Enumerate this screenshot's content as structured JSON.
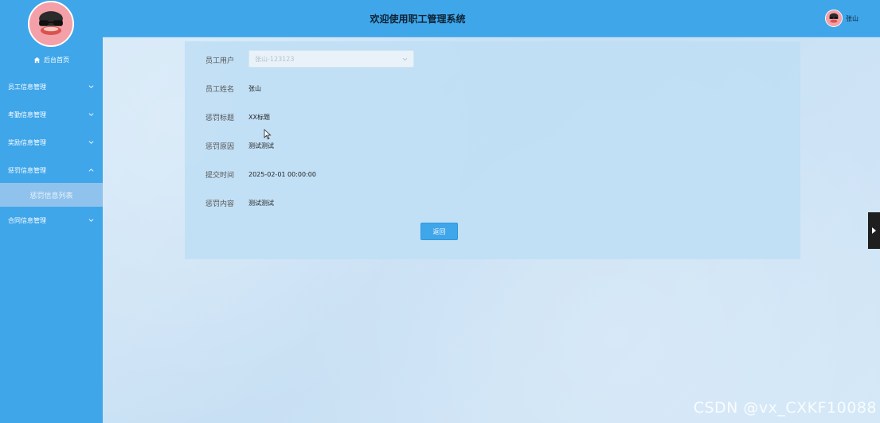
{
  "header": {
    "title": "欢迎使用职工管理系统",
    "user_name": "张山"
  },
  "sidebar": {
    "home_label": "后台首页",
    "menus": [
      {
        "label": "员工信息管理",
        "expanded": false
      },
      {
        "label": "考勤信息管理",
        "expanded": false
      },
      {
        "label": "奖励信息管理",
        "expanded": false
      },
      {
        "label": "惩罚信息管理",
        "expanded": true
      },
      {
        "label": "合同信息管理",
        "expanded": false
      }
    ],
    "active_submenu": "惩罚信息列表"
  },
  "form": {
    "fields": [
      {
        "label": "员工用户",
        "value": "张山-123123"
      },
      {
        "label": "员工姓名",
        "value": "张山"
      },
      {
        "label": "惩罚标题",
        "value": "XX标题"
      },
      {
        "label": "惩罚原因",
        "value": "测试测试"
      },
      {
        "label": "提交时间",
        "value": "2025-02-01 00:00:00"
      },
      {
        "label": "惩罚内容",
        "value": "测试测试"
      }
    ],
    "back_button": "返回"
  },
  "watermark": "CSDN @vx_CXKF10088",
  "colors": {
    "primary": "#3fa6ea",
    "sidebar_active": "#8fc2ec",
    "toggle": "#1f1f1f"
  }
}
